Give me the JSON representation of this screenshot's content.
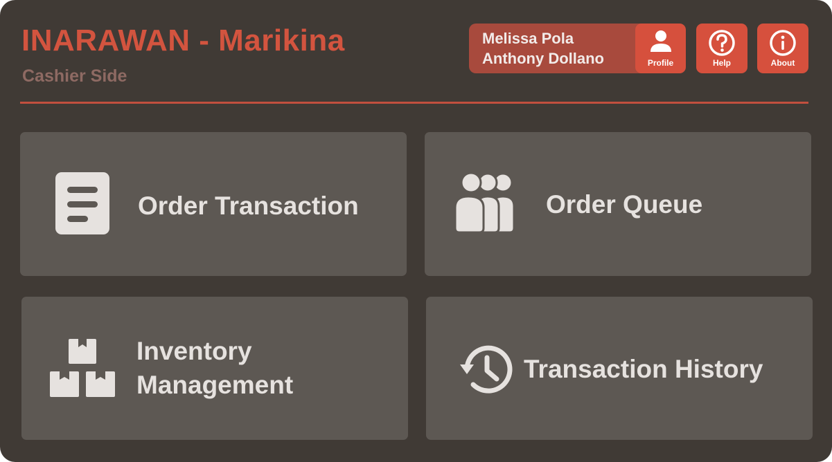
{
  "header": {
    "title": "INARAWAN - Marikina",
    "subtitle": "Cashier Side"
  },
  "user": {
    "line1": "Melissa Pola",
    "line2": "Anthony Dollano"
  },
  "toolbar": {
    "profile_label": "Profile",
    "help_label": "Help",
    "about_label": "About"
  },
  "tiles": {
    "order_transaction": "Order Transaction",
    "order_queue": "Order Queue",
    "inventory_line1": "Inventory",
    "inventory_line2": "Management",
    "transaction_history": "Transaction History"
  },
  "colors": {
    "background": "#403a35",
    "accent": "#d6503d",
    "tile": "#5d5853",
    "tile_text": "#e6e2df"
  },
  "icons": {
    "profile": "person-icon",
    "help": "question-circle-icon",
    "about": "info-circle-icon",
    "order_transaction": "document-lines-icon",
    "order_queue": "people-queue-icon",
    "inventory": "boxes-icon",
    "transaction_history": "history-clock-icon"
  }
}
